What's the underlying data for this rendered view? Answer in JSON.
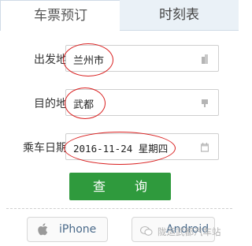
{
  "tabs": {
    "active": "车票预订",
    "inactive": "时刻表"
  },
  "form": {
    "origin_label": "出发地",
    "origin_value": "兰州市",
    "destination_label": "目的地",
    "destination_value": "武都",
    "date_label": "乘车日期",
    "date_value": "2016-11-24 星期四"
  },
  "search_button": "查 询",
  "apps": {
    "iphone": "iPhone",
    "android": "Android"
  },
  "watermark": "陇运武都汽车站",
  "colors": {
    "accent_green": "#2f9a3d",
    "annotation_red": "#d91f1f",
    "tab_inactive_bg": "#eaf1f7"
  }
}
